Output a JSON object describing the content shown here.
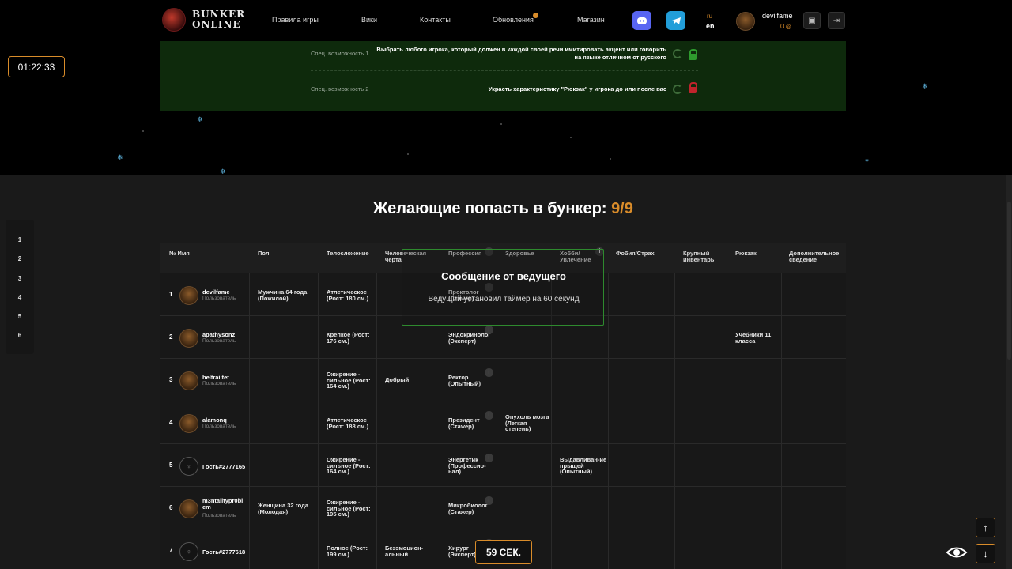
{
  "header": {
    "logo_line1": "BUNKER",
    "logo_line2": "ONLINE",
    "nav": [
      "Правила игры",
      "Вики",
      "Контакты",
      "Обновления",
      "Магазин"
    ],
    "lang_ru": "ru",
    "lang_en": "en",
    "username": "devilfame",
    "balance": "0"
  },
  "timer": "01:22:33",
  "abilities": [
    {
      "label": "Спец. возможность 1",
      "text": "Выбрать любого игрока, который должен в каждой своей речи имитировать акцент или говорить на языке отличном от русского",
      "locked": false
    },
    {
      "label": "Спец. возможность 2",
      "text": "Украсть характеристику \"Рюкзак\" у игрока до или после вас",
      "locked": true
    }
  ],
  "section": {
    "title": "Желающие попасть в бункер:",
    "count": "9/9"
  },
  "side_nums": [
    "1",
    "2",
    "3",
    "4",
    "5",
    "6"
  ],
  "columns": [
    "№ Имя",
    "Пол",
    "Телосложение",
    "Человеческая черта",
    "Профессия",
    "Здоровье",
    "Хобби/ Увлечение",
    "Фобия/Страх",
    "Крупный инвентарь",
    "Рюкзак",
    "Дополнительное сведение"
  ],
  "rows": [
    {
      "n": "1",
      "name": "devilfame",
      "role": "Пользователь",
      "guest": false,
      "sex": "Мужчина 64 года (Пожилой)",
      "body": "Атлетическое (Рост: 180 см.)",
      "trait": "",
      "prof": "Проктолог (Стажер)",
      "health": "",
      "hobby": "",
      "phobia": "",
      "inv": "",
      "bag": "",
      "extra": ""
    },
    {
      "n": "2",
      "name": "apathysonz",
      "role": "Пользователь",
      "guest": false,
      "sex": "",
      "body": "Крепкое (Рост: 176 см.)",
      "trait": "",
      "prof": "Эндокринолог (Эксперт)",
      "health": "",
      "hobby": "",
      "phobia": "",
      "inv": "",
      "bag": "Учебники 11 класса",
      "extra": ""
    },
    {
      "n": "3",
      "name": "heltraiitet",
      "role": "Пользователь",
      "guest": false,
      "sex": "",
      "body": "Ожирение - сильное (Рост: 164 см.)",
      "trait": "Добрый",
      "prof": "Ректор (Опытный)",
      "health": "",
      "hobby": "",
      "phobia": "",
      "inv": "",
      "bag": "",
      "extra": ""
    },
    {
      "n": "4",
      "name": "alamonq",
      "role": "Пользователь",
      "guest": false,
      "sex": "",
      "body": "Атлетическое (Рост: 188 см.)",
      "trait": "",
      "prof": "Президент (Стажер)",
      "health": "Опухоль мозга (Легкая степень)",
      "hobby": "",
      "phobia": "",
      "inv": "",
      "bag": "",
      "extra": ""
    },
    {
      "n": "5",
      "name": "Гость#2777165",
      "role": "",
      "guest": true,
      "sex": "",
      "body": "Ожирение - сильное (Рост: 164 см.)",
      "trait": "",
      "prof": "Энергетик (Профессио-нал)",
      "health": "",
      "hobby": "Выдавливан-ие прыщей (Опытный)",
      "phobia": "",
      "inv": "",
      "bag": "",
      "extra": ""
    },
    {
      "n": "6",
      "name": "m3ntalitypr0bl em",
      "role": "Пользователь",
      "guest": false,
      "sex": "Женщина 32 года (Молодая)",
      "body": "Ожирение - сильное (Рост: 195 см.)",
      "trait": "",
      "prof": "Микробиолог (Стажер)",
      "health": "",
      "hobby": "",
      "phobia": "",
      "inv": "",
      "bag": "",
      "extra": ""
    },
    {
      "n": "7",
      "name": "Гость#2777618",
      "role": "",
      "guest": true,
      "sex": "",
      "body": "Полное (Рост: 199 см.)",
      "trait": "Безэмоцион-альный",
      "prof": "Хирург (Эксперт)",
      "health": "",
      "hobby": "",
      "phobia": "",
      "inv": "",
      "bag": "",
      "extra": ""
    }
  ],
  "overlay": {
    "title": "Сообщение от ведущего",
    "message": "Ведущий установил таймер на 60 секунд"
  },
  "countdown": "59 СЕК.",
  "info_glyph": "i",
  "icons": {
    "discord": "discord-icon",
    "telegram": "telegram-icon",
    "up": "↑",
    "down": "↓"
  },
  "colors": {
    "accent": "#d98c2a",
    "panel_green": "#0e2a0c",
    "discord": "#5865f2",
    "telegram": "#229ed9",
    "lock_open": "#2e9a2e",
    "lock_closed": "#c0242c"
  }
}
